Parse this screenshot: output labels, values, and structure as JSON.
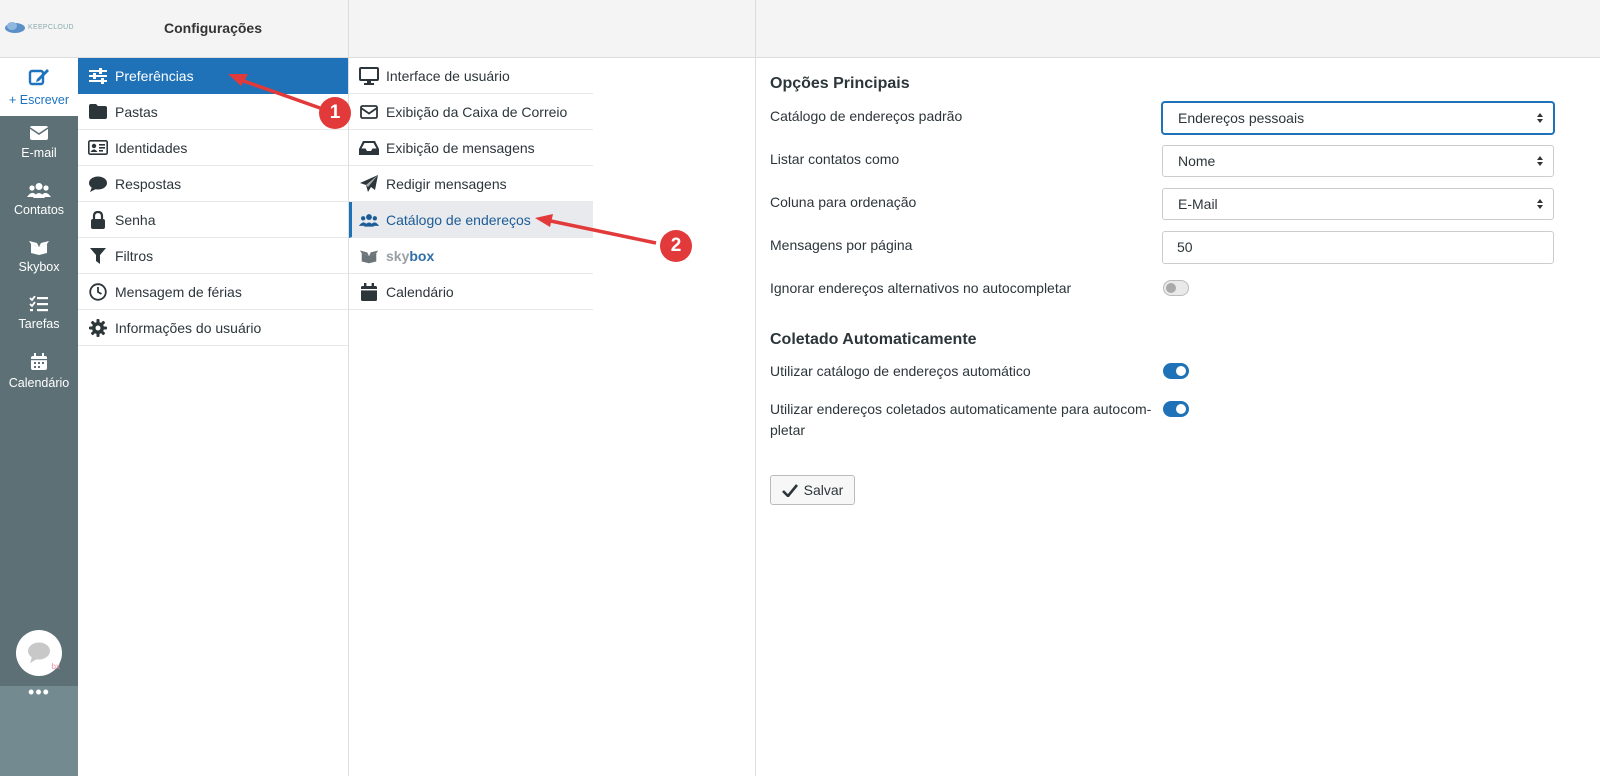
{
  "app": {
    "logo_text": "KEEPCLOUD",
    "header_title": "Configurações"
  },
  "rail": {
    "compose_label": "+ Escrever",
    "items": [
      {
        "label": "E-mail",
        "icon": "envelope-icon"
      },
      {
        "label": "Contatos",
        "icon": "users-icon"
      },
      {
        "label": "Skybox",
        "icon": "box-icon"
      },
      {
        "label": "Tarefas",
        "icon": "tasks-icon"
      },
      {
        "label": "Calendário",
        "icon": "calendar-icon"
      }
    ],
    "chat_badge": "bx",
    "more_label": "•••"
  },
  "settings": {
    "items": [
      {
        "label": "Preferências",
        "icon": "sliders-icon",
        "active": true
      },
      {
        "label": "Pastas",
        "icon": "folder-icon"
      },
      {
        "label": "Identidades",
        "icon": "id-card-icon"
      },
      {
        "label": "Respostas",
        "icon": "comment-icon"
      },
      {
        "label": "Senha",
        "icon": "lock-icon"
      },
      {
        "label": "Filtros",
        "icon": "filter-icon"
      },
      {
        "label": "Mensagem de férias",
        "icon": "clock-icon"
      },
      {
        "label": "Informações do usuário",
        "icon": "gear-icon"
      }
    ]
  },
  "prefs": {
    "items": [
      {
        "label": "Interface de usuário",
        "icon": "monitor-icon"
      },
      {
        "label": "Exibição da Caixa de Correio",
        "icon": "envelope-outline-icon"
      },
      {
        "label": "Exibição de mensagens",
        "icon": "inbox-icon"
      },
      {
        "label": "Redigir mensagens",
        "icon": "paper-plane-icon"
      },
      {
        "label": "Catálogo de endereços",
        "icon": "users-icon",
        "selected": true
      },
      {
        "label_part1": "sky",
        "label_part2": "box",
        "icon": "box-icon"
      },
      {
        "label": "Calendário",
        "icon": "calendar-icon"
      }
    ]
  },
  "content": {
    "section1_title": "Opções Principais",
    "fields": {
      "default_addressbook": {
        "label": "Catálogo de endereços padrão",
        "value": "Endereços pessoais"
      },
      "list_contacts_as": {
        "label": "Listar contatos como",
        "value": "Nome"
      },
      "sort_column": {
        "label": "Coluna para ordenação",
        "value": "E-Mail"
      },
      "messages_per_page": {
        "label": "Mensagens por página",
        "value": "50"
      },
      "ignore_alt_addresses": {
        "label": "Ignorar endereços alternativos no autocompletar",
        "enabled": false
      }
    },
    "section2_title": "Coletado Automaticamente",
    "auto_fields": {
      "use_auto_addressbook": {
        "label": "Utilizar catálogo de endereços automático",
        "enabled": true
      },
      "use_collected_autocomplete": {
        "label": "Utilizar endereços coletados automaticamente para autocom-pletar",
        "line1": "Utilizar endereços coletados automaticamente para autocom-",
        "line2": "pletar",
        "enabled": true
      }
    },
    "save_label": "Salvar"
  },
  "annotations": {
    "step1": "1",
    "step2": "2",
    "arrow_color": "#e23a3a"
  }
}
